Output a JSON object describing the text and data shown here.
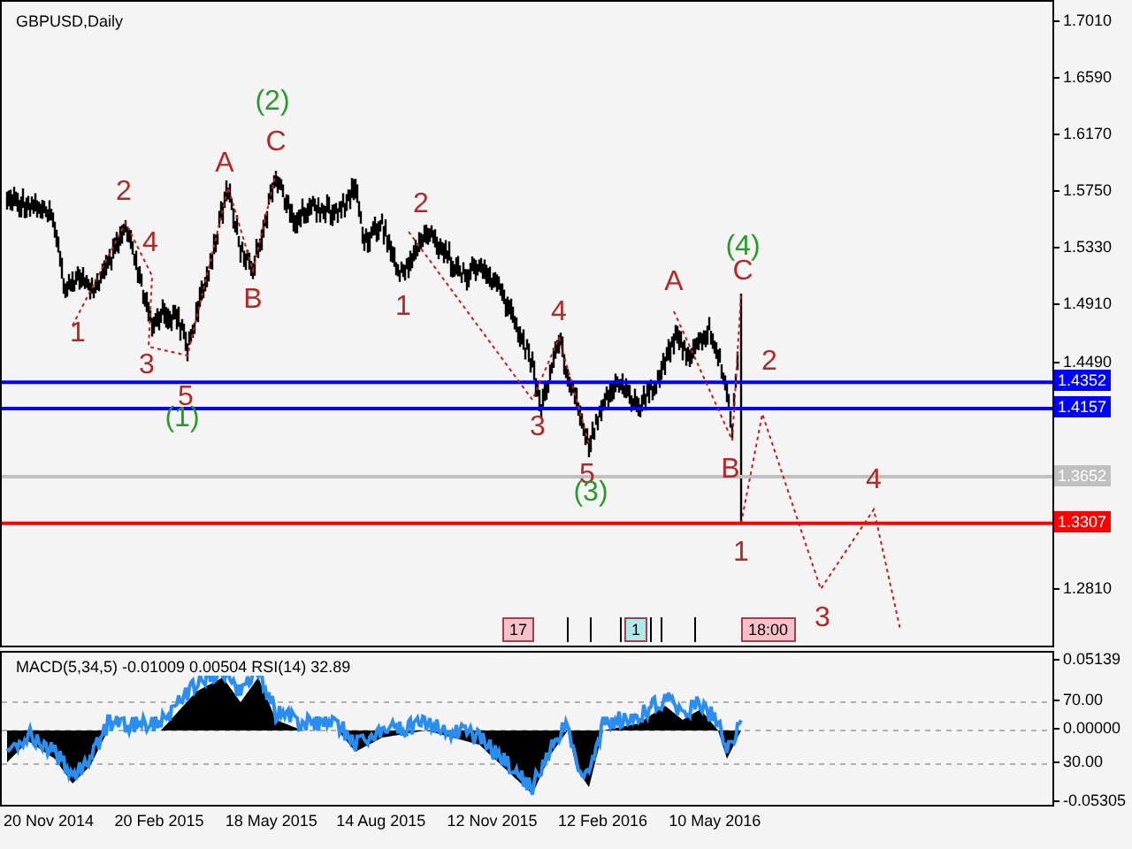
{
  "chart": {
    "title": "GBPUSD,Daily",
    "price_ticks": [
      "1.7010",
      "1.6590",
      "1.6170",
      "1.5750",
      "1.5330",
      "1.4910",
      "1.4490",
      "1.2810"
    ],
    "levels": [
      {
        "value": "1.4352",
        "color": "#0000ff"
      },
      {
        "value": "1.4157",
        "color": "#0000ff"
      },
      {
        "value": "1.3652",
        "color": "#c0c0c0"
      },
      {
        "value": "1.3307",
        "color": "#ff0000"
      }
    ],
    "wave_labels": [
      {
        "text": "1",
        "kind": "minor"
      },
      {
        "text": "2",
        "kind": "minor"
      },
      {
        "text": "4",
        "kind": "minor"
      },
      {
        "text": "3",
        "kind": "minor"
      },
      {
        "text": "5",
        "kind": "minor"
      },
      {
        "text": "(1)",
        "kind": "major"
      },
      {
        "text": "A",
        "kind": "minor"
      },
      {
        "text": "B",
        "kind": "minor"
      },
      {
        "text": "C",
        "kind": "minor"
      },
      {
        "text": "(2)",
        "kind": "major"
      },
      {
        "text": "1",
        "kind": "minor"
      },
      {
        "text": "2",
        "kind": "minor"
      },
      {
        "text": "3",
        "kind": "minor"
      },
      {
        "text": "4",
        "kind": "minor"
      },
      {
        "text": "5",
        "kind": "minor"
      },
      {
        "text": "(3)",
        "kind": "major"
      },
      {
        "text": "A",
        "kind": "minor"
      },
      {
        "text": "(4)",
        "kind": "major"
      },
      {
        "text": "C",
        "kind": "minor"
      },
      {
        "text": "B",
        "kind": "minor"
      },
      {
        "text": "1",
        "kind": "minor"
      },
      {
        "text": "2",
        "kind": "minor"
      },
      {
        "text": "3",
        "kind": "minor"
      },
      {
        "text": "4",
        "kind": "minor"
      }
    ],
    "events": [
      {
        "text": "17",
        "color": "#f8c0c8"
      },
      {
        "text": "1",
        "color": "#b0e8e8"
      },
      {
        "text": "18:00",
        "color": "#f8c0c8"
      }
    ]
  },
  "indicator": {
    "title": "MACD(5,34,5) -0.01009 0.00504 RSI(14) 32.89",
    "scale": [
      "0.05139",
      "70.00",
      "0.00000",
      "30.00",
      "-0.05305"
    ]
  },
  "dates": [
    "20 Nov 2014",
    "20 Feb 2015",
    "18 May 2015",
    "14 Aug 2015",
    "12 Nov 2015",
    "12 Feb 2016",
    "10 May 2016"
  ]
}
